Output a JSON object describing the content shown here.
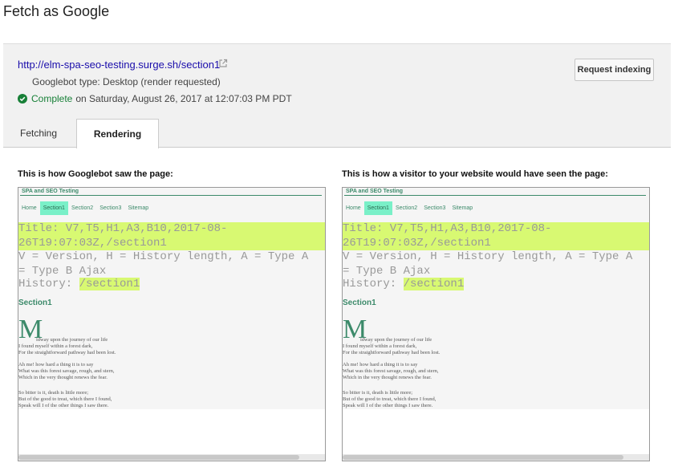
{
  "page_title": "Fetch as Google",
  "url": {
    "link": "http://elm-spa-seo-testing.surge.sh/section1",
    "googlebot_type": "Googlebot type: Desktop (render requested)",
    "status": "Complete",
    "status_detail": "on Saturday, August 26, 2017 at 12:07:03 PM PDT",
    "request_indexing_label": "Request indexing"
  },
  "tabs": [
    {
      "label": "Fetching",
      "active": false
    },
    {
      "label": "Rendering",
      "active": true
    }
  ],
  "columns": {
    "googlebot_title": "This is how Googlebot saw the page:",
    "visitor_title": "This is how a visitor to your website would have seen the page:"
  },
  "render": {
    "site_title": "SPA and SEO Testing",
    "nav": [
      "Home",
      "Section1",
      "Section2",
      "Section3",
      "Sitemap"
    ],
    "nav_active": "Section1",
    "debug_line_1": "Title: V7,T5,H1,A3,B10,2017-08-",
    "debug_line_2": "26T19:07:03Z,/section1",
    "legend_line_1": "V = Version, H = History length, A = Type A",
    "legend_line_2": "= Type B Ajax",
    "history_label": "History:",
    "history_value": "/section1",
    "section_heading": "Section1",
    "dropcap": "M",
    "poem": [
      "idway upon the journey of our life",
      "I found myself within a forest dark,",
      "For the straightforward pathway had been lost.",
      "",
      "Ah me! how hard a thing it is to say",
      "What was this forest savage, rough, and stern,",
      "Which in the very thought renews the fear.",
      "",
      "So bitter is it, death is little more;",
      "But of the good to treat, which there I found,",
      "Speak will I of the other things I saw there."
    ]
  },
  "colors": {
    "accent_green": "#3c8a6a",
    "highlight": "#d8f972",
    "active_nav": "#7af0c8",
    "link": "#1a0dab",
    "status_green": "#188038"
  }
}
